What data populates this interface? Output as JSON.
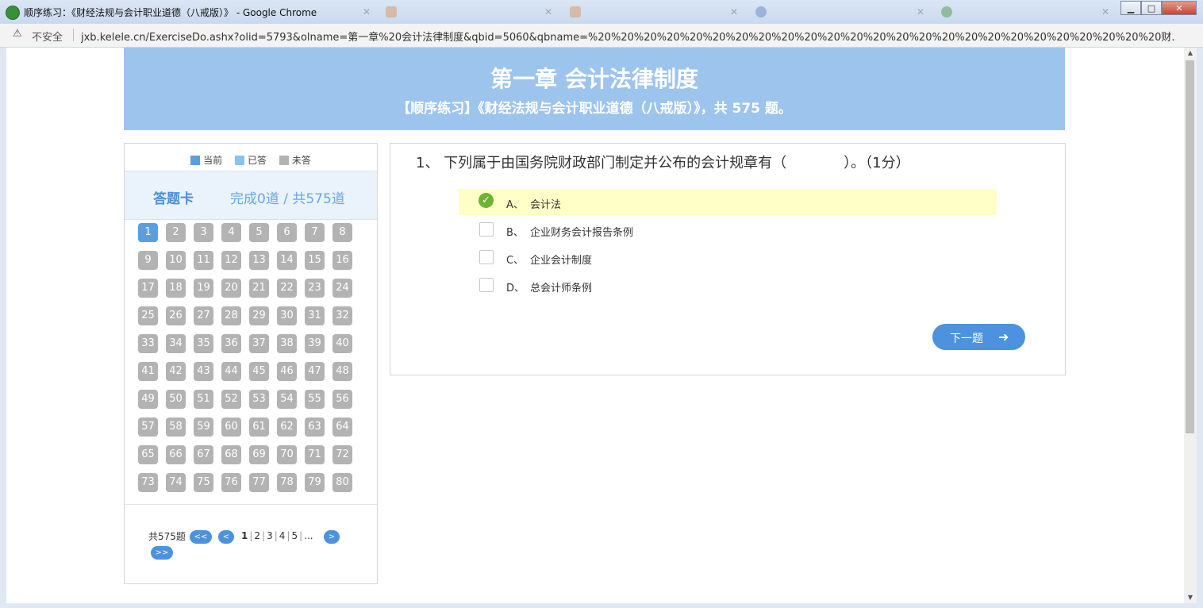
{
  "window": {
    "title": "顺序练习：《财经法规与会计职业道德（八戒版）》 - Google Chrome",
    "controls": {
      "minimize": "▁",
      "maximize": "□",
      "close": "✕"
    }
  },
  "address": {
    "security_label": "不安全",
    "url": "jxb.kelele.cn/ExerciseDo.ashx?olid=5793&olname=第一章%20会计法律制度&qbid=5060&qbname=%20%20%20%20%20%20%20%20%20%20%20%20%20%20%20%20%20%20%20%20%20%20%20%20%20财..."
  },
  "banner": {
    "title": "第一章 会计法律制度",
    "subtitle": "【顺序练习】《财经法规与会计职业道德（八戒版）》，共 575 题。"
  },
  "legend": [
    {
      "label": "当前",
      "color": "#5b9ee0"
    },
    {
      "label": "已答",
      "color": "#87c3f2"
    },
    {
      "label": "未答",
      "color": "#b3b3b3"
    }
  ],
  "answer_card": {
    "title": "答题卡",
    "progress": "完成0道 / 共575道",
    "current": 1,
    "numbers": [
      "1",
      "2",
      "3",
      "4",
      "5",
      "6",
      "7",
      "8",
      "9",
      "10",
      "11",
      "12",
      "13",
      "14",
      "15",
      "16",
      "17",
      "18",
      "19",
      "20",
      "21",
      "22",
      "23",
      "24",
      "25",
      "26",
      "27",
      "28",
      "29",
      "30",
      "31",
      "32",
      "33",
      "34",
      "35",
      "36",
      "37",
      "38",
      "39",
      "40",
      "41",
      "42",
      "43",
      "44",
      "45",
      "46",
      "47",
      "48",
      "49",
      "50",
      "51",
      "52",
      "53",
      "54",
      "55",
      "56",
      "57",
      "58",
      "59",
      "60",
      "61",
      "62",
      "63",
      "64",
      "65",
      "66",
      "67",
      "68",
      "69",
      "70",
      "71",
      "72",
      "73",
      "74",
      "75",
      "76",
      "77",
      "78",
      "79",
      "80"
    ]
  },
  "pager": {
    "total": "共575题",
    "first": "<<",
    "prev": "<",
    "pages": [
      "1",
      "2",
      "3",
      "4",
      "5"
    ],
    "ellipsis": "...",
    "next": ">",
    "last": ">>"
  },
  "question": {
    "text": "1、 下列属于由国务院财政部门制定并公布的会计规章有（　　　　）。（1分）",
    "options": [
      {
        "letter": "A、",
        "text": "会计法",
        "selected": true
      },
      {
        "letter": "B、",
        "text": "企业财务会计报告条例",
        "selected": false
      },
      {
        "letter": "C、",
        "text": "企业会计制度",
        "selected": false
      },
      {
        "letter": "D、",
        "text": "总会计师条例",
        "selected": false
      }
    ],
    "next_label": "下一题"
  }
}
